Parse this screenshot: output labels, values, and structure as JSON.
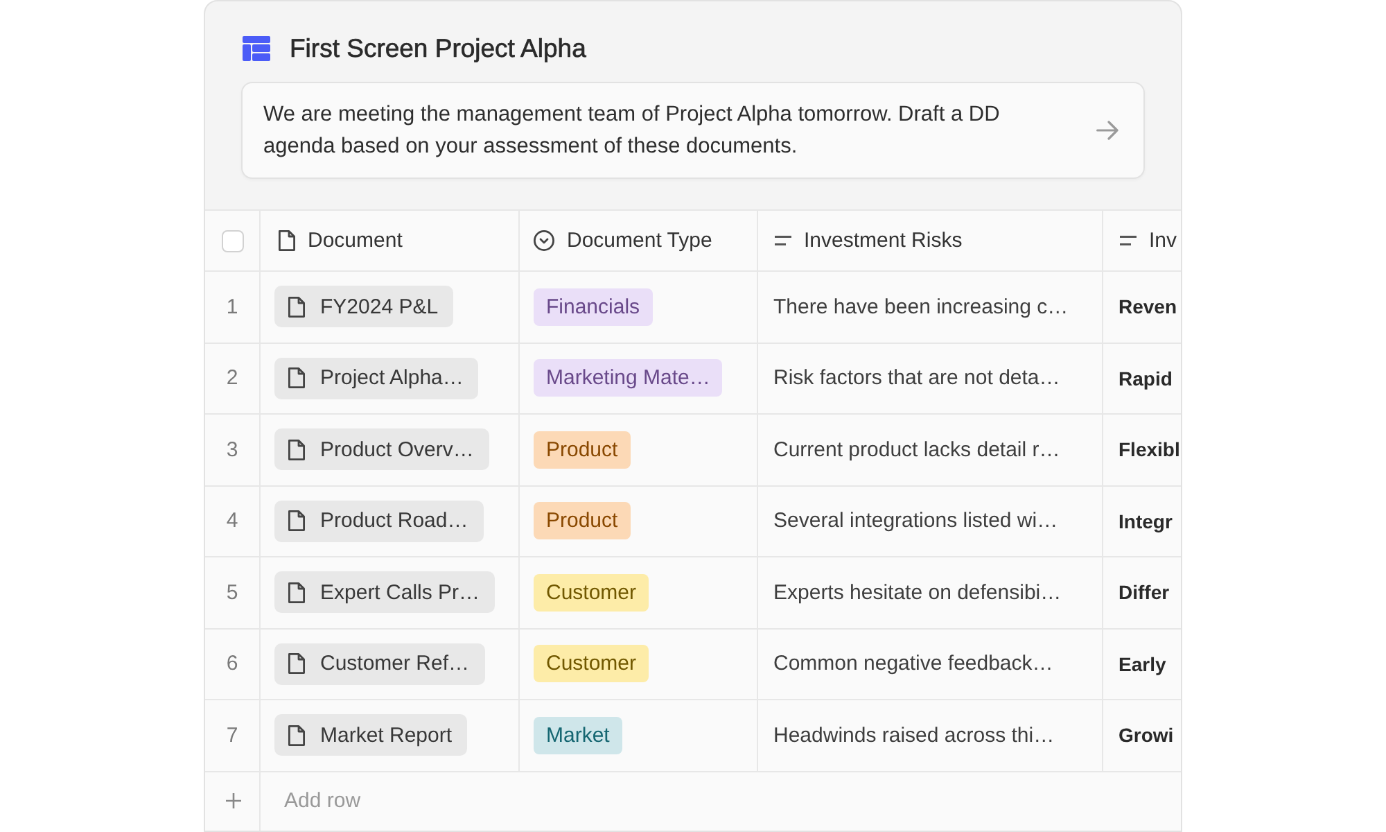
{
  "header": {
    "title": "First Screen Project Alpha"
  },
  "prompt": {
    "value": "We are meeting the management team of Project Alpha tomorrow. Draft a DD agenda based on your assessment of these documents."
  },
  "table": {
    "select_all": {
      "checked": false
    },
    "columns": [
      {
        "label": "Document",
        "kind": "file"
      },
      {
        "label": "Document Type",
        "kind": "select"
      },
      {
        "label": "Investment Risks",
        "kind": "text"
      },
      {
        "label": "Inv",
        "kind": "text"
      }
    ],
    "rows": [
      {
        "number": "1",
        "document": "FY2024 P&L",
        "document_type": {
          "label": "Financials",
          "color": "#eadff8"
        },
        "investment_risks": "There have been increasing c…",
        "column_5": "Reven"
      },
      {
        "number": "2",
        "document": "Project Alpha…",
        "document_type": {
          "label": "Marketing Mate…",
          "color": "#eadff8"
        },
        "investment_risks": "Risk factors that are not deta…",
        "column_5": "Rapid"
      },
      {
        "number": "3",
        "document": "Product Overv…",
        "document_type": {
          "label": "Product",
          "color": "#fcd9b6"
        },
        "investment_risks": "Current product lacks detail r…",
        "column_5": "Flexibl"
      },
      {
        "number": "4",
        "document": "Product Road…",
        "document_type": {
          "label": "Product",
          "color": "#fcd9b6"
        },
        "investment_risks": "Several integrations listed wi…",
        "column_5": "Integr"
      },
      {
        "number": "5",
        "document": "Expert Calls Pr…",
        "document_type": {
          "label": "Customer",
          "color": "#fdeca8"
        },
        "investment_risks": "Experts hesitate on defensibi…",
        "column_5": "Differ"
      },
      {
        "number": "6",
        "document": "Customer Ref…",
        "document_type": {
          "label": "Customer",
          "color": "#fdeca8"
        },
        "investment_risks": "Common negative feedback…",
        "column_5": "Early"
      },
      {
        "number": "7",
        "document": "Market Report",
        "document_type": {
          "label": "Market",
          "color": "#cfe6ea"
        },
        "investment_risks": "Headwinds raised across thi…",
        "column_5": "Growi"
      }
    ],
    "add_row": {
      "label": "Add row"
    }
  }
}
